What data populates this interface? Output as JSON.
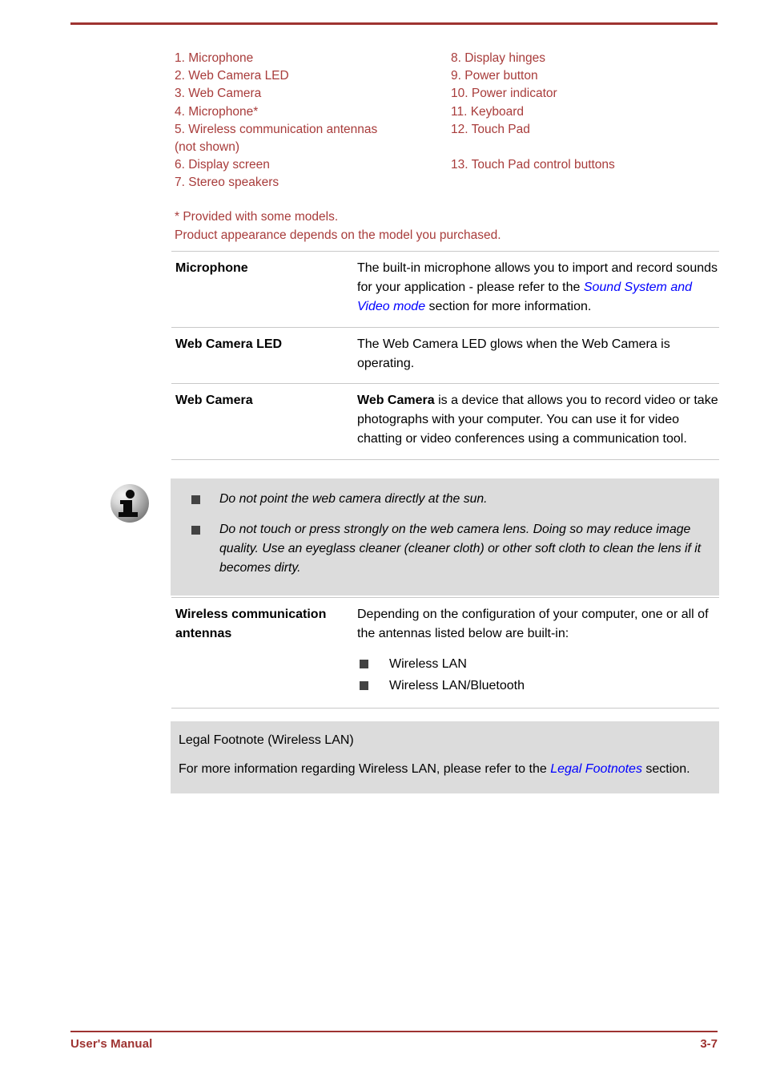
{
  "document": {
    "footer_left": "User's Manual",
    "page_number": "3-7",
    "accent_color": "#9e3331",
    "list_color": "#a83c3b",
    "link_color": "#0000ff",
    "note_bg": "#dcdcdc"
  },
  "parts_list": {
    "left_column": [
      "1. Microphone",
      "2. Web Camera LED",
      "3. Web Camera",
      "4. Microphone*",
      "5. Wireless communication antennas",
      "(not shown)",
      "6. Display screen",
      "7. Stereo speakers"
    ],
    "right_column": [
      "8. Display hinges",
      "9. Power button",
      "10. Power indicator",
      "11. Keyboard",
      "12. Touch Pad",
      "",
      "13. Touch Pad control buttons",
      ""
    ]
  },
  "footnotes": {
    "line1": "* Provided with some models.",
    "line2": "Product appearance depends on the model you purchased."
  },
  "table_top": {
    "rows": [
      {
        "term": "Microphone",
        "desc_pre": "The built-in microphone allows you to import and record sounds for your application - please refer to the ",
        "desc_link": "Sound System and Video mode",
        "desc_post": " section for more information."
      },
      {
        "term": "Web Camera LED",
        "desc_pre": "The Web Camera LED glows when the Web Camera is operating.",
        "desc_link": "",
        "desc_post": ""
      },
      {
        "term": "Web Camera",
        "desc_bold": "Web Camera",
        "desc_pre": " is a device that allows you to record video or take photographs with your computer. You can use it for video chatting or video conferences using a communication tool.",
        "desc_link": "",
        "desc_post": ""
      }
    ]
  },
  "info_note": {
    "icon": "info-icon",
    "bullets": [
      "Do not point the web camera directly at the sun.",
      "Do not touch or press strongly on the web camera lens. Doing so may reduce image quality. Use an eyeglass cleaner (cleaner cloth) or other soft cloth to clean the lens if it becomes dirty."
    ]
  },
  "table_bottom": {
    "term": "Wireless communication antennas",
    "desc": "Depending on the configuration of your computer, one or all of the antennas listed below are built-in:",
    "bullets": [
      "Wireless LAN",
      "Wireless LAN/Bluetooth"
    ]
  },
  "legal_footnote": {
    "title": "Legal Footnote (Wireless LAN)",
    "body_pre": "For more information regarding Wireless LAN, please refer to the ",
    "body_link": "Legal Footnotes",
    "body_post": " section."
  }
}
